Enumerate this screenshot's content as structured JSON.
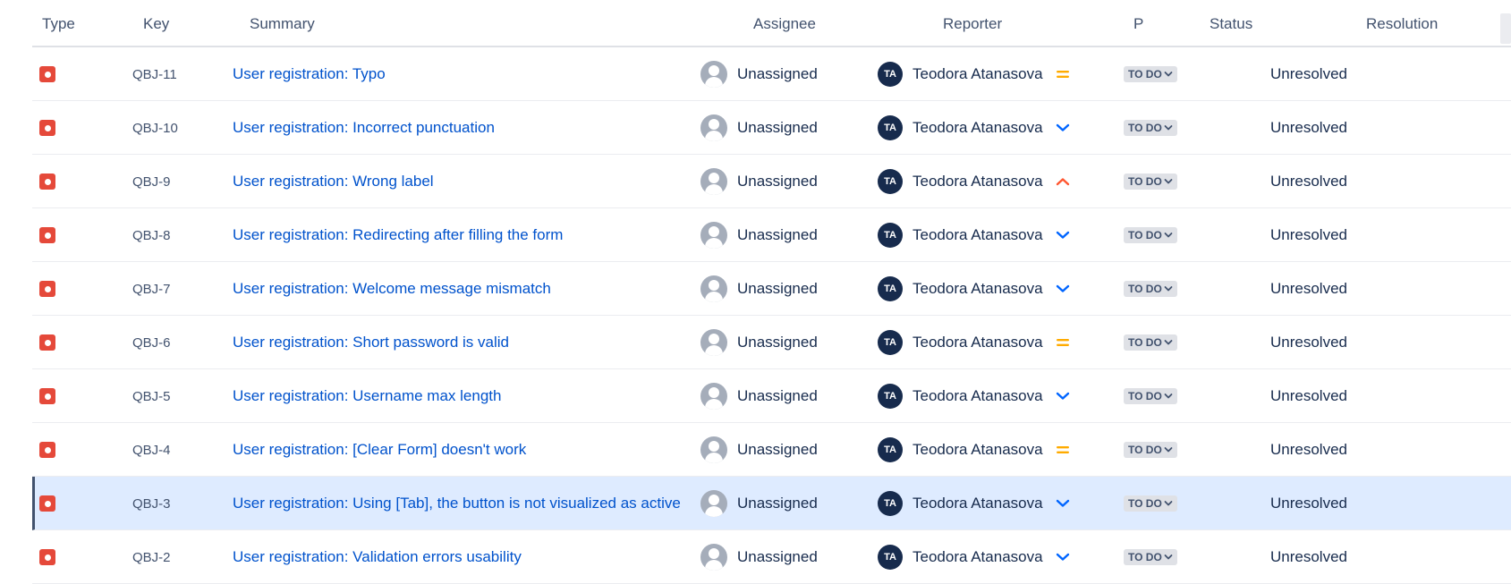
{
  "columns": {
    "type": "Type",
    "key": "Key",
    "summary": "Summary",
    "assignee": "Assignee",
    "reporter": "Reporter",
    "priority": "P",
    "status": "Status",
    "resolution": "Resolution"
  },
  "colors": {
    "bug_red": "#e5493a",
    "link_blue": "#0052cc",
    "priority_medium": "#ffab00",
    "priority_low": "#0065ff",
    "priority_high": "#ff5630",
    "selected_row": "#deebff"
  },
  "issues": [
    {
      "type_icon": "bug-icon",
      "key": "QBJ-11",
      "summary": "User registration: Typo",
      "assignee": "Unassigned",
      "reporter_initials": "TA",
      "reporter": "Teodora Atanasova",
      "priority": "medium",
      "status": "TO DO",
      "resolution": "Unresolved",
      "selected": false
    },
    {
      "type_icon": "bug-icon",
      "key": "QBJ-10",
      "summary": "User registration: Incorrect punctuation",
      "assignee": "Unassigned",
      "reporter_initials": "TA",
      "reporter": "Teodora Atanasova",
      "priority": "low",
      "status": "TO DO",
      "resolution": "Unresolved",
      "selected": false
    },
    {
      "type_icon": "bug-icon",
      "key": "QBJ-9",
      "summary": "User registration: Wrong label",
      "assignee": "Unassigned",
      "reporter_initials": "TA",
      "reporter": "Teodora Atanasova",
      "priority": "high",
      "status": "TO DO",
      "resolution": "Unresolved",
      "selected": false
    },
    {
      "type_icon": "bug-icon",
      "key": "QBJ-8",
      "summary": "User registration: Redirecting after filling the form",
      "assignee": "Unassigned",
      "reporter_initials": "TA",
      "reporter": "Teodora Atanasova",
      "priority": "low",
      "status": "TO DO",
      "resolution": "Unresolved",
      "selected": false
    },
    {
      "type_icon": "bug-icon",
      "key": "QBJ-7",
      "summary": "User registration: Welcome message mismatch",
      "assignee": "Unassigned",
      "reporter_initials": "TA",
      "reporter": "Teodora Atanasova",
      "priority": "low",
      "status": "TO DO",
      "resolution": "Unresolved",
      "selected": false
    },
    {
      "type_icon": "bug-icon",
      "key": "QBJ-6",
      "summary": "User registration: Short password is valid",
      "assignee": "Unassigned",
      "reporter_initials": "TA",
      "reporter": "Teodora Atanasova",
      "priority": "medium",
      "status": "TO DO",
      "resolution": "Unresolved",
      "selected": false
    },
    {
      "type_icon": "bug-icon",
      "key": "QBJ-5",
      "summary": "User registration: Username max length",
      "assignee": "Unassigned",
      "reporter_initials": "TA",
      "reporter": "Teodora Atanasova",
      "priority": "low",
      "status": "TO DO",
      "resolution": "Unresolved",
      "selected": false
    },
    {
      "type_icon": "bug-icon",
      "key": "QBJ-4",
      "summary": "User registration: [Clear Form] doesn't work",
      "assignee": "Unassigned",
      "reporter_initials": "TA",
      "reporter": "Teodora Atanasova",
      "priority": "medium",
      "status": "TO DO",
      "resolution": "Unresolved",
      "selected": false
    },
    {
      "type_icon": "bug-icon",
      "key": "QBJ-3",
      "summary": "User registration: Using [Tab], the button is not visualized as active",
      "assignee": "Unassigned",
      "reporter_initials": "TA",
      "reporter": "Teodora Atanasova",
      "priority": "low",
      "status": "TO DO",
      "resolution": "Unresolved",
      "selected": true
    },
    {
      "type_icon": "bug-icon",
      "key": "QBJ-2",
      "summary": "User registration: Validation errors usability",
      "assignee": "Unassigned",
      "reporter_initials": "TA",
      "reporter": "Teodora Atanasova",
      "priority": "low",
      "status": "TO DO",
      "resolution": "Unresolved",
      "selected": false
    }
  ]
}
